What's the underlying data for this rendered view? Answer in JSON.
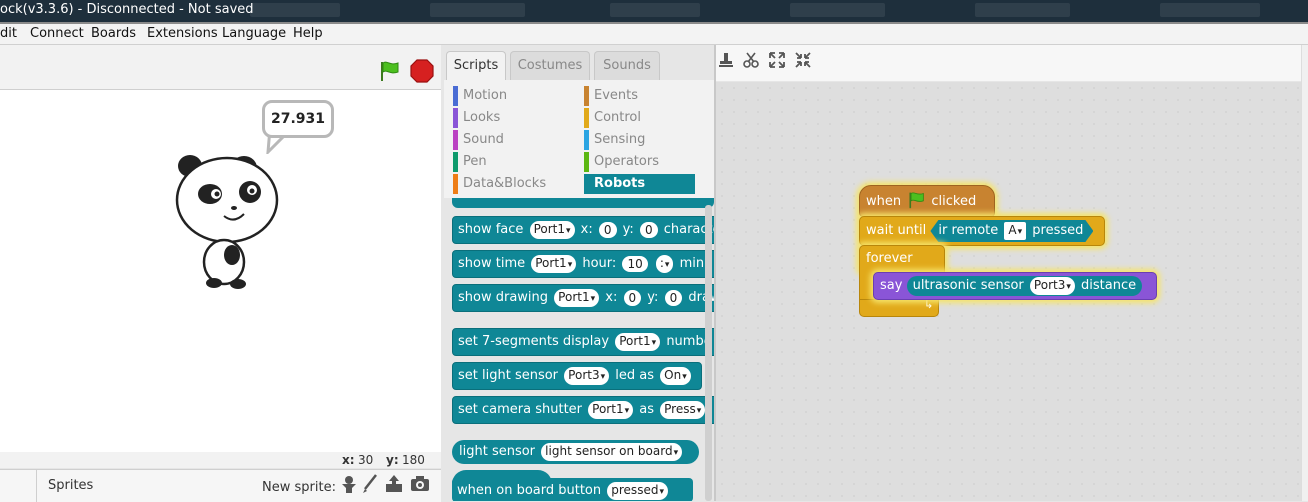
{
  "window": {
    "title": "ock(v3.3.6) - Disconnected - Not saved"
  },
  "menu": [
    "dit",
    "Connect",
    "Boards",
    "Extensions",
    "Language",
    "Help"
  ],
  "stage": {
    "speech_bubble": "27.931",
    "x_label": "x:",
    "x_value": "30",
    "y_label": "y:",
    "y_value": "180",
    "sprites_label": "Sprites",
    "new_sprite_label": "New sprite:"
  },
  "palette": {
    "tabs": [
      "Scripts",
      "Costumes",
      "Sounds"
    ],
    "categories_left": [
      "Motion",
      "Looks",
      "Sound",
      "Pen",
      "Data&Blocks"
    ],
    "categories_right": [
      "Events",
      "Control",
      "Sensing",
      "Operators",
      "Robots"
    ],
    "selected_category": "Robots",
    "category_colors": {
      "Motion": "#4a6cd4",
      "Looks": "#8a55d7",
      "Sound": "#bb42c3",
      "Pen": "#0e9a6c",
      "Data&Blocks": "#ee7d16",
      "Events": "#c88330",
      "Control": "#e1a91a",
      "Sensing": "#2ca5e2",
      "Operators": "#5cb712",
      "Robots": "#0f8796"
    },
    "blocks": {
      "face": {
        "t1": "show face",
        "port": "Port1",
        "t2": "x:",
        "x": "0",
        "t3": "y:",
        "y": "0",
        "t4": "characte"
      },
      "time": {
        "t1": "show time",
        "port": "Port1",
        "t2": "hour:",
        "hour": "10",
        "sep": ":",
        "t3": "min:"
      },
      "drawing": {
        "t1": "show drawing",
        "port": "Port1",
        "t2": "x:",
        "x": "0",
        "t3": "y:",
        "y": "0",
        "t4": "draw"
      },
      "seg": {
        "t1": "set 7-segments display",
        "port": "Port1",
        "t2": "numbe"
      },
      "light": {
        "t1": "set light sensor",
        "port": "Port3",
        "t2": "led as",
        "state": "On"
      },
      "camera": {
        "t1": "set camera shutter",
        "port": "Port1",
        "t2": "as",
        "state": "Press"
      },
      "lightrep": {
        "t1": "light sensor",
        "opt": "light sensor on board"
      },
      "button": {
        "t1": "when on board button",
        "opt": "pressed"
      }
    }
  },
  "script": {
    "hat": {
      "t1": "when",
      "t2": "clicked"
    },
    "wait": {
      "t1": "wait until",
      "t2": "ir remote",
      "key": "A",
      "t3": "pressed"
    },
    "forever": "forever",
    "say": {
      "t1": "say",
      "t2": "ultrasonic sensor",
      "port": "Port3",
      "t3": "distance"
    }
  }
}
